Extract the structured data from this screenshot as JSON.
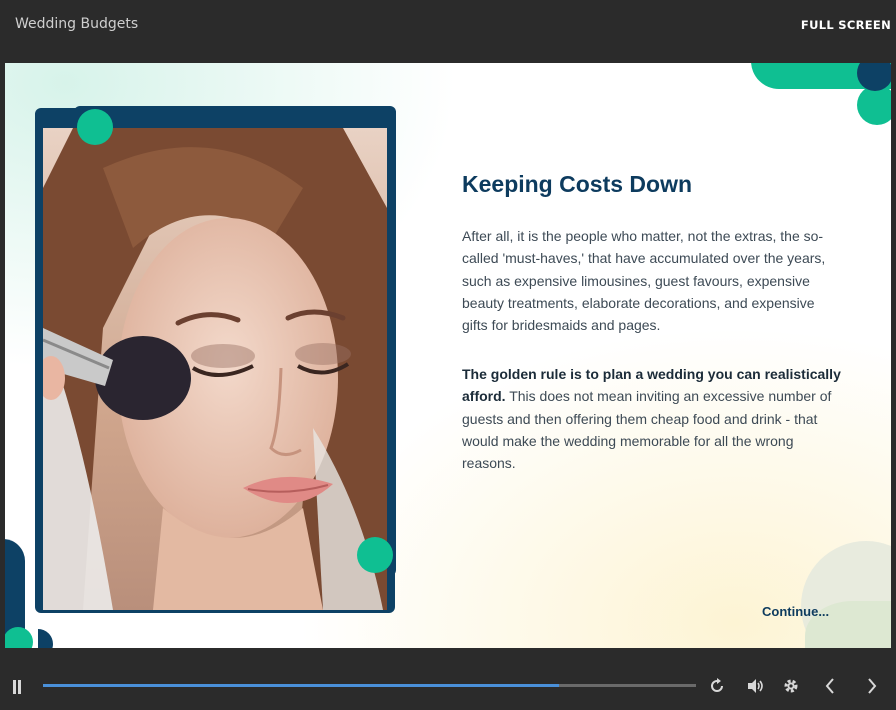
{
  "header": {
    "title": "Wedding Budgets",
    "fullscreen_label": "FULL SCREEN"
  },
  "slide": {
    "heading": "Keeping Costs Down",
    "paragraph1": "After all, it is the people who matter, not the extras, the so-called 'must-haves,' that have accumulated over the years, such as expensive limousines, guest favours, expensive beauty treatments, elaborate decorations, and expensive gifts for bridesmaids and pages.",
    "paragraph2_bold": "The golden rule is to plan a wedding you can realistically afford.",
    "paragraph2_rest": " This does not mean inviting an excessive number of guests and then offering them cheap food and drink - that would make the wedding memorable for all the wrong reasons.",
    "continue_label": "Continue...",
    "photo_icon": "photo-bride-makeup"
  },
  "player": {
    "progress_fraction": 0.79,
    "icons": [
      "pause-icon",
      "replay-icon",
      "volume-icon",
      "gear-icon",
      "chevron-left-icon",
      "chevron-right-icon"
    ]
  },
  "colors": {
    "accent_green": "#0fbf92",
    "navy": "#0d4165",
    "heading": "#0d3b5e",
    "progress": "#4a90d9"
  }
}
